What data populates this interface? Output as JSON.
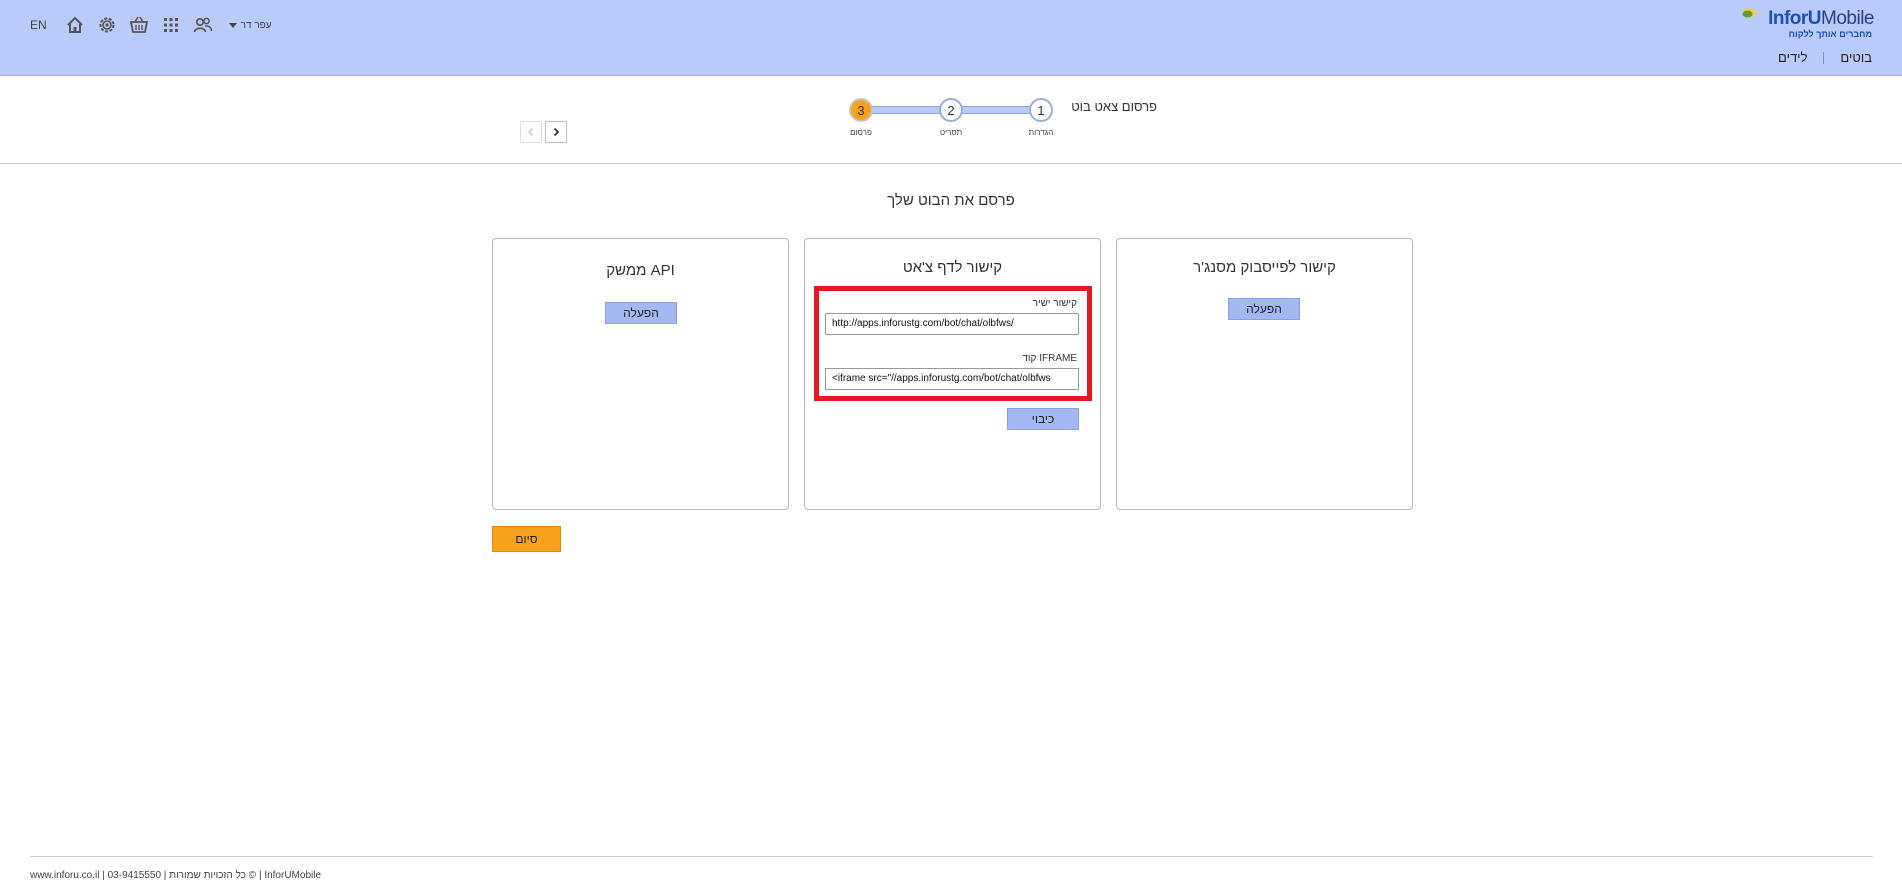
{
  "header": {
    "lang": "EN",
    "user_name": "עפר דר",
    "icons": [
      "home-icon",
      "gear-icon",
      "basket-icon",
      "apps-grid-icon",
      "users-icon"
    ],
    "logo_main": "InforU",
    "logo_main_light": "Mobile",
    "logo_tagline": "מחברים אותך ללקוח",
    "nav": [
      {
        "label": "בוטים"
      },
      {
        "label": "לידים"
      }
    ]
  },
  "wizard": {
    "title": "פרסום צאט בוט",
    "steps": [
      {
        "number": "1",
        "label": "הגדרות",
        "active": false
      },
      {
        "number": "2",
        "label": "תסריט",
        "active": false
      },
      {
        "number": "3",
        "label": "פרסום",
        "active": true
      }
    ]
  },
  "main": {
    "title": "פרסם את הבוט שלך",
    "cards": {
      "facebook": {
        "title": "קישור לפייסבוק מסנג'ר",
        "button": "הפעלה"
      },
      "chat": {
        "title": "קישור לדף צ'אט",
        "direct_label": "קישור ישיר",
        "direct_value": "http://apps.inforustg.com/bot/chat/olbfws/",
        "iframe_label": "קוד IFRAME",
        "iframe_value": "<iframe src=\"//apps.inforustg.com/bot/chat/olbfws",
        "copy_button": "כיבוי"
      },
      "api": {
        "title": "ממשק API",
        "button": "הפעלה"
      }
    },
    "finish_button": "סיום"
  },
  "footer": {
    "text": "www.inforu.co.il | 03-9415550 | כל הזכויות שמורות © | InforUMobile"
  },
  "colors": {
    "header_bg": "#b9cafb",
    "accent_orange": "#f7a21a",
    "button_blue": "#a3b8f3",
    "highlight_red": "#e11b22"
  }
}
